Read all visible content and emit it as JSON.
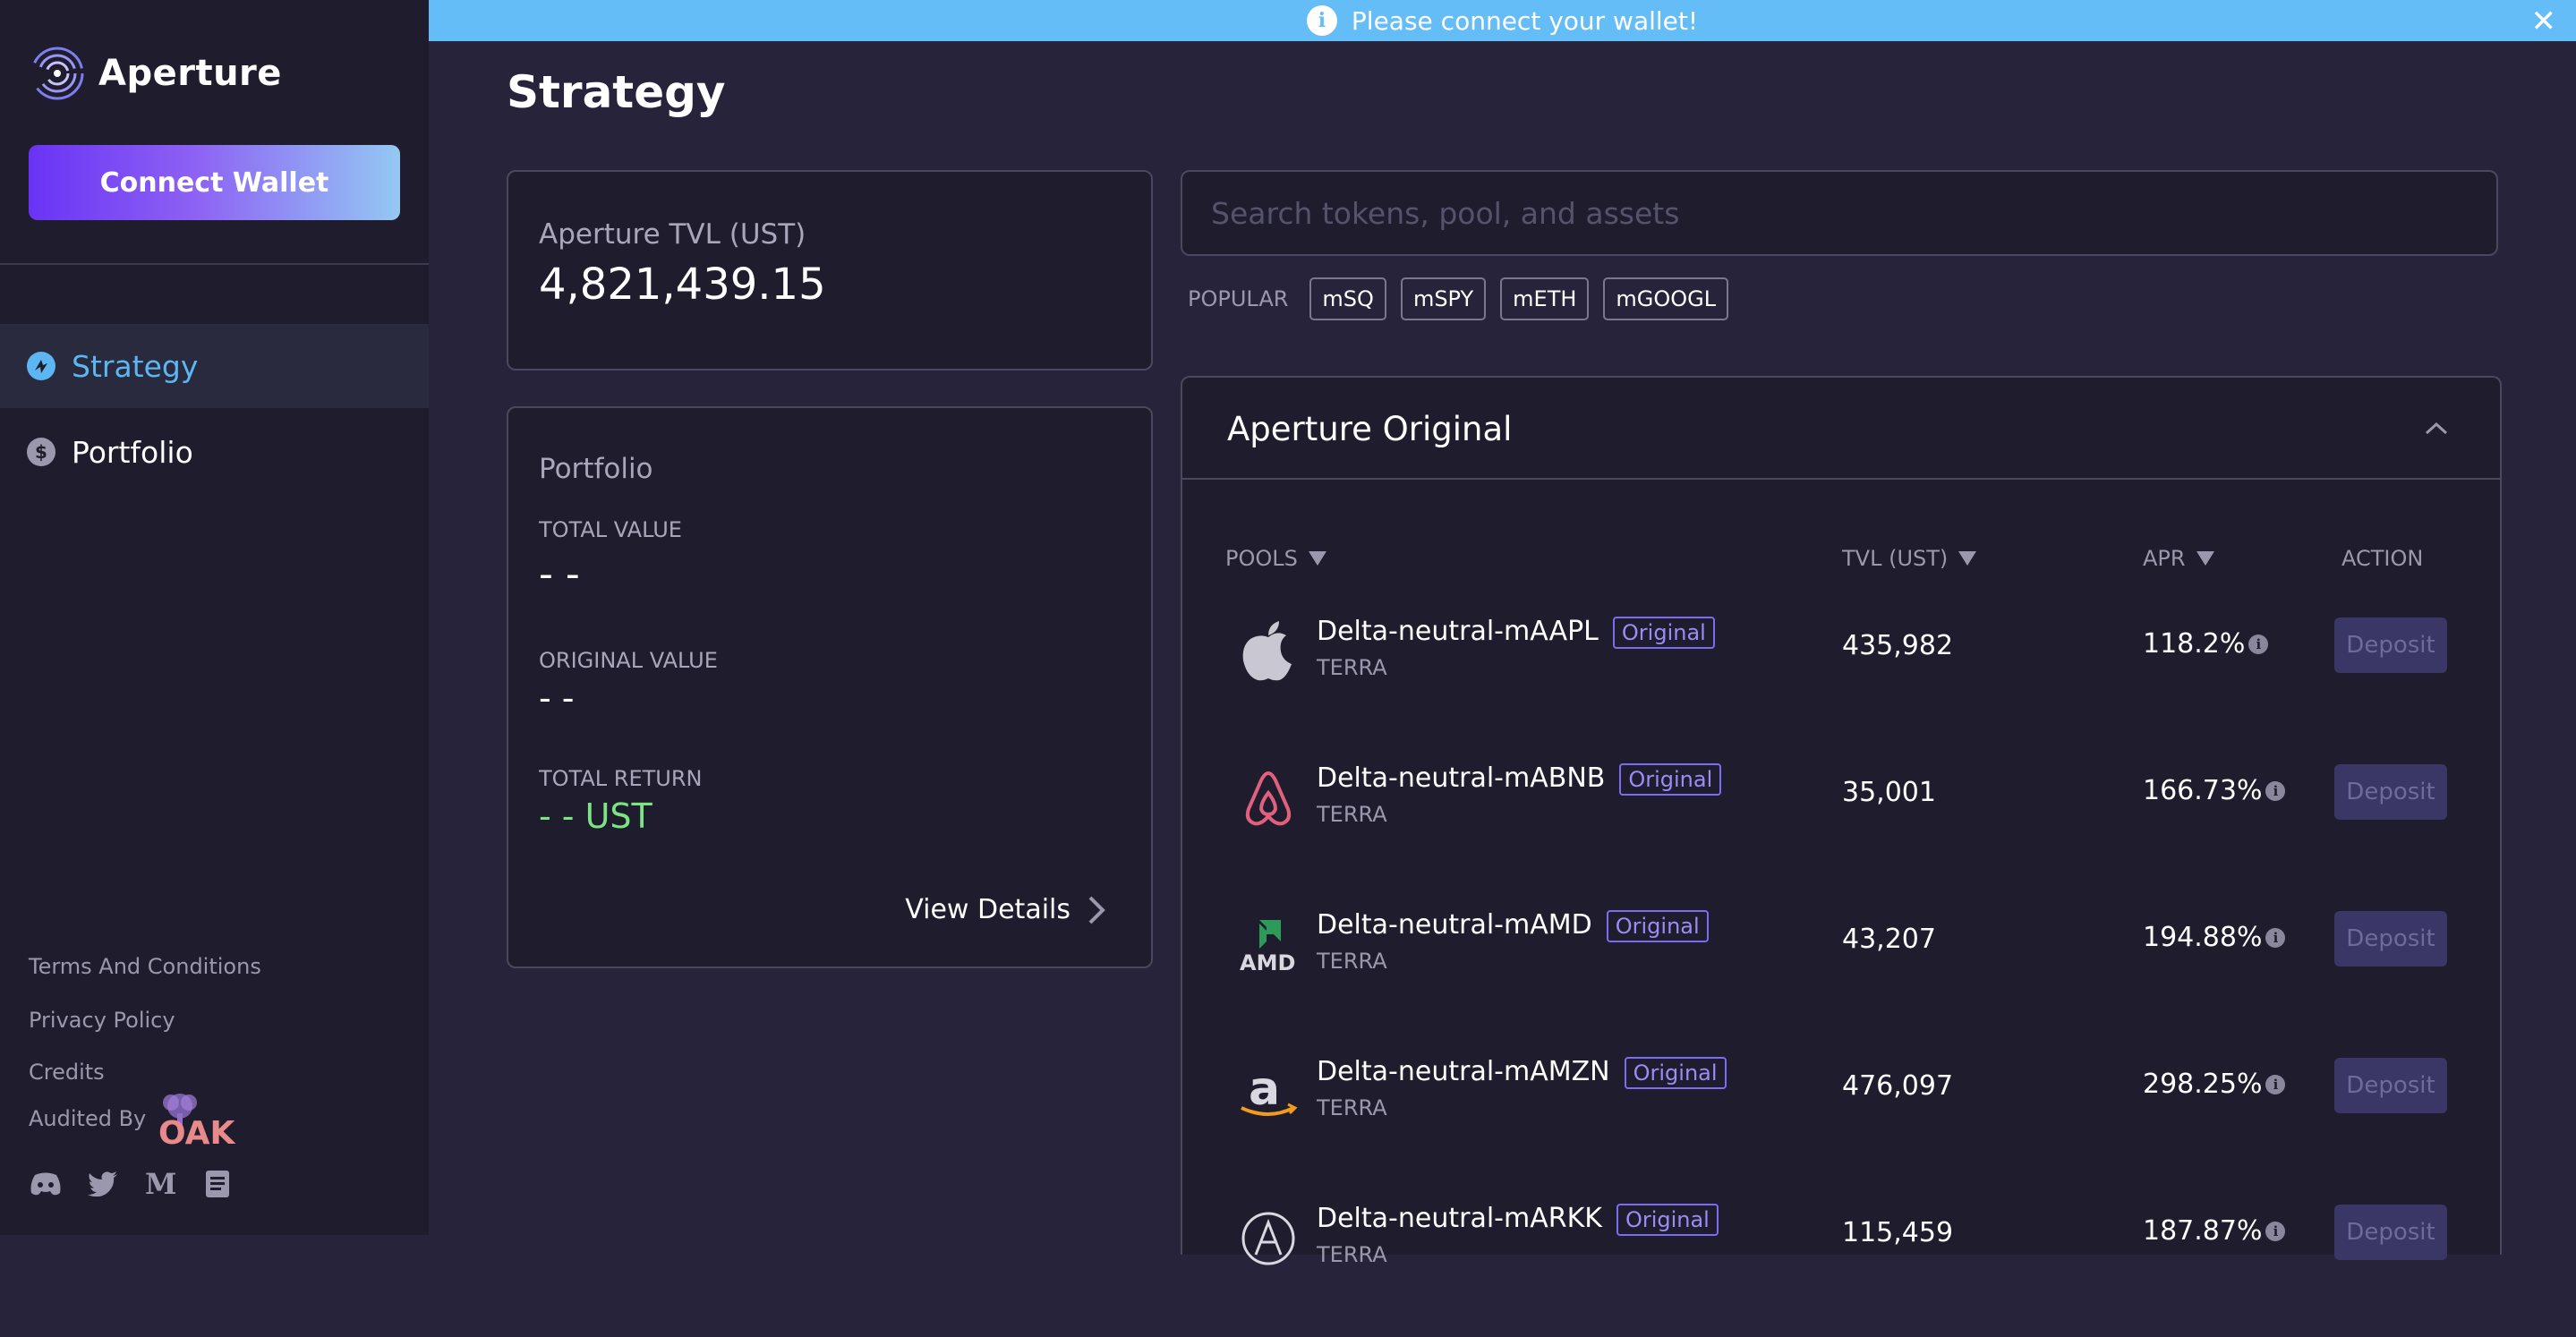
{
  "brand": {
    "name": "Aperture"
  },
  "sidebar": {
    "connect_label": "Connect Wallet",
    "nav": [
      {
        "label": "Strategy",
        "icon": "strategy-icon",
        "active": true
      },
      {
        "label": "Portfolio",
        "icon": "dollar-icon",
        "active": false
      }
    ],
    "footer": {
      "terms": "Terms And Conditions",
      "privacy": "Privacy Policy",
      "credits": "Credits",
      "audited_by": "Audited By",
      "auditor_logo": "OAK"
    },
    "socials": [
      "discord-icon",
      "twitter-icon",
      "medium-icon",
      "docs-icon"
    ]
  },
  "banner": {
    "text": "Please connect your wallet!",
    "close": "✕"
  },
  "page": {
    "title": "Strategy"
  },
  "tvl": {
    "label": "Aperture TVL (UST)",
    "value": "4,821,439.15"
  },
  "portfolio": {
    "title": "Portfolio",
    "total_value_label": "TOTAL VALUE",
    "total_value": "- -",
    "original_value_label": "ORIGINAL VALUE",
    "original_value": "- -",
    "total_return_label": "TOTAL RETURN",
    "total_return": "- - UST",
    "view_details": "View Details"
  },
  "search": {
    "placeholder": "Search tokens, pool, and assets"
  },
  "popular": {
    "label": "POPULAR",
    "chips": [
      "mSQ",
      "mSPY",
      "mETH",
      "mGOOGL"
    ]
  },
  "original": {
    "title": "Aperture Original",
    "headers": {
      "pools": "POOLS",
      "tvl": "TVL (UST)",
      "apr": "APR",
      "action": "ACTION"
    },
    "badge": "Original",
    "deposit": "Deposit",
    "rows": [
      {
        "name": "Delta-neutral-mAAPL",
        "chain": "TERRA",
        "tvl": "435,982",
        "apr": "118.2%",
        "icon": "apple-icon"
      },
      {
        "name": "Delta-neutral-mABNB",
        "chain": "TERRA",
        "tvl": "35,001",
        "apr": "166.73%",
        "icon": "airbnb-icon"
      },
      {
        "name": "Delta-neutral-mAMD",
        "chain": "TERRA",
        "tvl": "43,207",
        "apr": "194.88%",
        "icon": "amd-icon"
      },
      {
        "name": "Delta-neutral-mAMZN",
        "chain": "TERRA",
        "tvl": "476,097",
        "apr": "298.25%",
        "icon": "amazon-icon"
      },
      {
        "name": "Delta-neutral-mARKK",
        "chain": "TERRA",
        "tvl": "115,459",
        "apr": "187.87%",
        "icon": "ark-icon"
      }
    ]
  },
  "colors": {
    "accent": "#5bb6f2",
    "banner": "#65bdf7",
    "return_green": "#7ae582",
    "badge": "#7b6cf0"
  }
}
